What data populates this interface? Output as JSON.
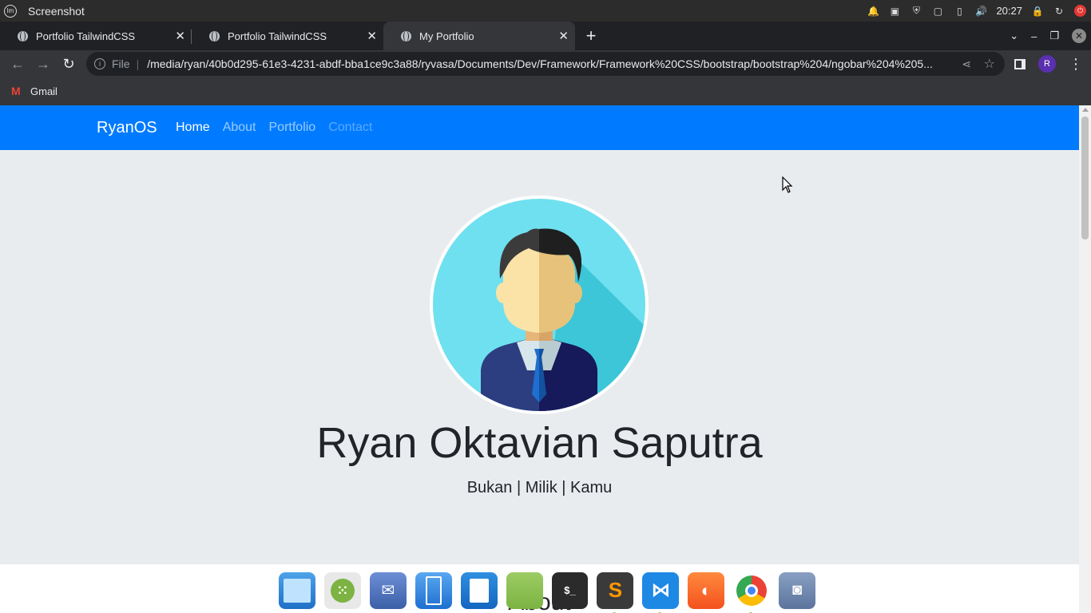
{
  "os": {
    "title": "Screenshot",
    "clock": "20:27"
  },
  "tabs": [
    {
      "label": "Portfolio TailwindCSS",
      "active": false
    },
    {
      "label": "Portfolio TailwindCSS",
      "active": false
    },
    {
      "label": "My Portfolio",
      "active": true
    }
  ],
  "toolbar": {
    "scheme_label": "File",
    "url": "/media/ryan/40b0d295-61e3-4231-abdf-bba1ce9c3a88/ryvasa/Documents/Dev/Framework/Framework%20CSS/bootstrap/bootstrap%204/ngobar%204%205...",
    "profile_initial": "R"
  },
  "bookmarks": [
    {
      "label": "Gmail"
    }
  ],
  "navbar": {
    "brand": "RyanOS",
    "links": [
      {
        "label": "Home"
      },
      {
        "label": "About"
      },
      {
        "label": "Portfolio"
      },
      {
        "label": "Contact"
      }
    ]
  },
  "hero": {
    "name": "Ryan Oktavian Saputra",
    "tagline": "Bukan | Milik | Kamu"
  },
  "about": {
    "heading": "About"
  },
  "colors": {
    "navbar": "#007bff",
    "page_bg": "#e9ecef",
    "avatar_bg": "#6fe0ef"
  },
  "dock": [
    {
      "name": "file-manager-icon"
    },
    {
      "name": "app-grid-icon"
    },
    {
      "name": "mail-icon"
    },
    {
      "name": "archive-icon"
    },
    {
      "name": "document-icon"
    },
    {
      "name": "folder-icon"
    },
    {
      "name": "terminal-icon"
    },
    {
      "name": "sublime-text-icon"
    },
    {
      "name": "vscode-icon"
    },
    {
      "name": "firefox-icon"
    },
    {
      "name": "chrome-icon"
    },
    {
      "name": "camera-icon"
    }
  ]
}
